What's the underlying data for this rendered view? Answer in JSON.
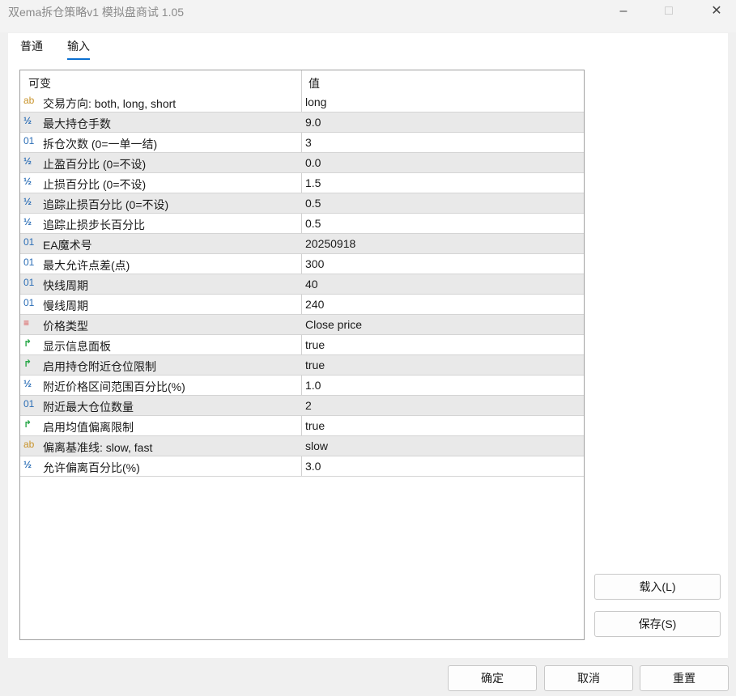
{
  "window": {
    "title": "双ema拆仓策略v1   模拟盘商试 1.05"
  },
  "tabs": [
    {
      "label": "普通"
    },
    {
      "label": "输入"
    }
  ],
  "table": {
    "headers": [
      "可变",
      "值"
    ],
    "rows": [
      {
        "icon": "ab",
        "name": "交易方向: both, long, short",
        "value": "long"
      },
      {
        "icon": "½",
        "name": "最大持仓手数",
        "value": "9.0"
      },
      {
        "icon": "01",
        "name": "拆仓次数 (0=一单一结)",
        "value": "3"
      },
      {
        "icon": "½",
        "name": "止盈百分比 (0=不设)",
        "value": "0.0"
      },
      {
        "icon": "½",
        "name": "止损百分比 (0=不设)",
        "value": "1.5"
      },
      {
        "icon": "½",
        "name": "追踪止损百分比 (0=不设)",
        "value": "0.5"
      },
      {
        "icon": "½",
        "name": "追踪止损步长百分比",
        "value": "0.5"
      },
      {
        "icon": "01",
        "name": "EA魔术号",
        "value": "20250918"
      },
      {
        "icon": "01",
        "name": "最大允许点差(点)",
        "value": "300"
      },
      {
        "icon": "01",
        "name": "快线周期",
        "value": "40"
      },
      {
        "icon": "01",
        "name": "慢线周期",
        "value": "240"
      },
      {
        "icon": "≡",
        "name": "价格类型",
        "value": "Close price"
      },
      {
        "icon": "↱",
        "name": "显示信息面板",
        "value": "true"
      },
      {
        "icon": "↱",
        "name": "启用持仓附近仓位限制",
        "value": "true"
      },
      {
        "icon": "½",
        "name": "附近价格区间范围百分比(%)",
        "value": "1.0"
      },
      {
        "icon": "01",
        "name": "附近最大仓位数量",
        "value": "2"
      },
      {
        "icon": "↱",
        "name": "启用均值偏离限制",
        "value": "true"
      },
      {
        "icon": "ab",
        "name": "偏离基准线: slow, fast",
        "value": "slow"
      },
      {
        "icon": "½",
        "name": "允许偏离百分比(%)",
        "value": "3.0"
      }
    ]
  },
  "side_buttons": {
    "load": "载入(L)",
    "save": "保存(S)"
  },
  "footer_buttons": {
    "ok": "确定",
    "cancel": "取消",
    "reset": "重置"
  }
}
